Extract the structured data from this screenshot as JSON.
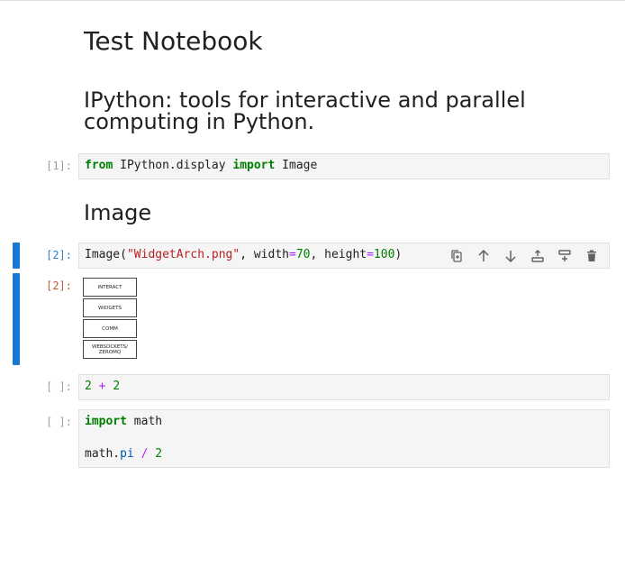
{
  "notebook": {
    "title": "Test Notebook",
    "subtitle": "IPython: tools for interactive and parallel computing in Python.",
    "section_heading": "Image"
  },
  "cells": [
    {
      "prompt": "[1]:",
      "tokens": {
        "kw1": "from",
        "module": " IPython.display ",
        "kw2": "import",
        "name": " Image"
      }
    },
    {
      "prompt": "[2]:",
      "output_prompt": "[2]:",
      "tokens": {
        "fn": "Image(",
        "str": "\"WidgetArch.png\"",
        "p1": ", width",
        "eq1": "=",
        "n1": "70",
        "p2": ", height",
        "eq2": "=",
        "n2": "100",
        "close": ")"
      },
      "output_image_labels": [
        "INTERACT",
        "WIDGETS",
        "COMM",
        "WEBSOCKETS/ ZEROMQ"
      ]
    },
    {
      "prompt": "[ ]:",
      "tokens": {
        "a": "2",
        "op": " + ",
        "b": "2"
      }
    },
    {
      "prompt": "[ ]:",
      "tokens": {
        "kw": "import",
        "mod": " math",
        "obj": "math.",
        "attr": "pi",
        "op": " / ",
        "num": "2"
      }
    }
  ],
  "toolbar": {
    "icons": [
      "duplicate-icon",
      "move-up-icon",
      "move-down-icon",
      "insert-above-icon",
      "insert-below-icon",
      "delete-icon"
    ]
  },
  "colors": {
    "active_bar": "#1976d2",
    "keyword": "#008000",
    "string": "#ba2121",
    "operator": "#aa22ff"
  }
}
